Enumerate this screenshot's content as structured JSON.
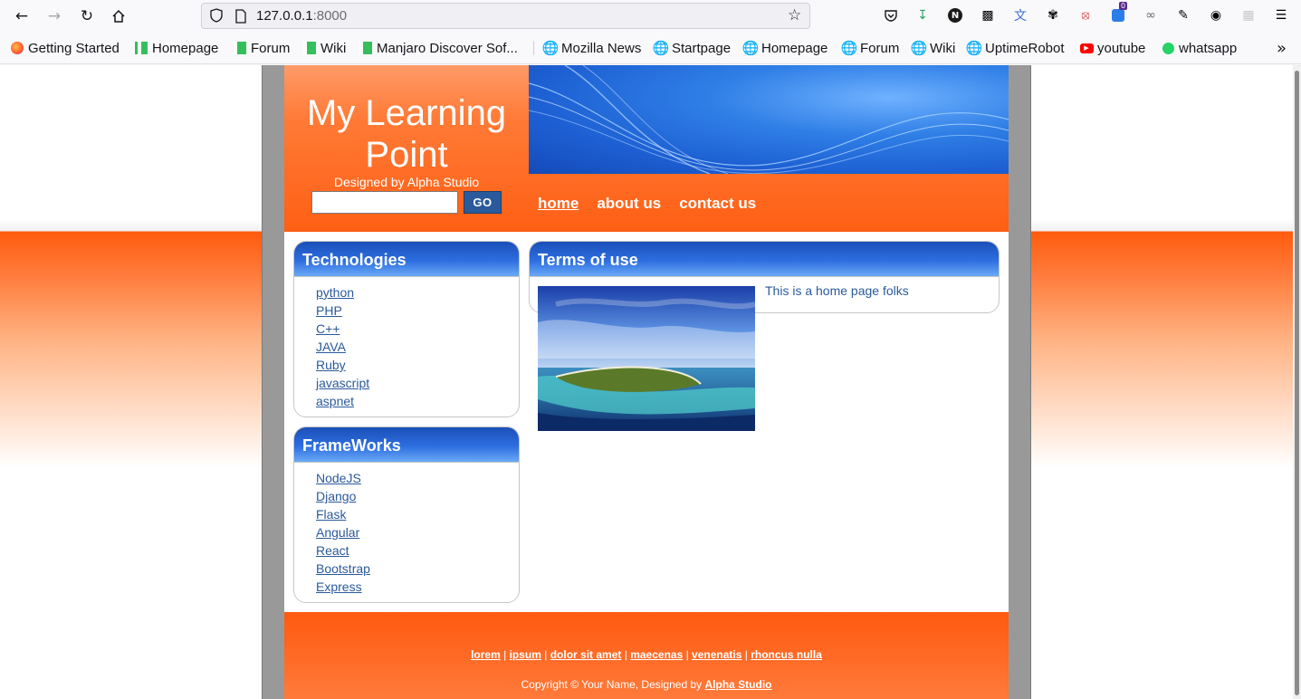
{
  "browser": {
    "url_host": "127.0.0.1",
    "url_port": ":8000",
    "extension_badge": "0",
    "bookmarks": [
      "Getting Started",
      "Homepage",
      "Forum",
      "Wiki",
      "Manjaro Discover Sof...",
      "Mozilla News",
      "Startpage",
      "Homepage",
      "Forum",
      "Wiki",
      "UptimeRobot",
      "youtube",
      "whatsapp"
    ]
  },
  "site": {
    "title": "My Learning Point",
    "tagline": "Designed by Alpha Studio",
    "search_button": "GO",
    "menu": [
      "home",
      "about us",
      "contact us"
    ]
  },
  "sidebar": {
    "technologies": {
      "title": "Technologies",
      "items": [
        "python",
        "PHP",
        "C++",
        "JAVA",
        "Ruby",
        "javascript",
        "aspnet"
      ]
    },
    "frameworks": {
      "title": "FrameWorks",
      "items": [
        "NodeJS",
        "Django",
        "Flask",
        "Angular",
        "React",
        "Bootstrap",
        "Express"
      ]
    }
  },
  "content": {
    "title": "Terms of use",
    "text": "This is a home page folks"
  },
  "footer": {
    "links": [
      "lorem",
      "ipsum",
      "dolor sit amet",
      "maecenas",
      "venenatis",
      "rhoncus nulla"
    ],
    "copyright_prefix": "Copyright © Your Name, Designed by",
    "copyright_link": "Alpha Studio"
  },
  "colors": {
    "accent_orange": "#ff5f14",
    "box_title_blue": "#2d6ee0",
    "link_blue": "#2a5a9b"
  }
}
